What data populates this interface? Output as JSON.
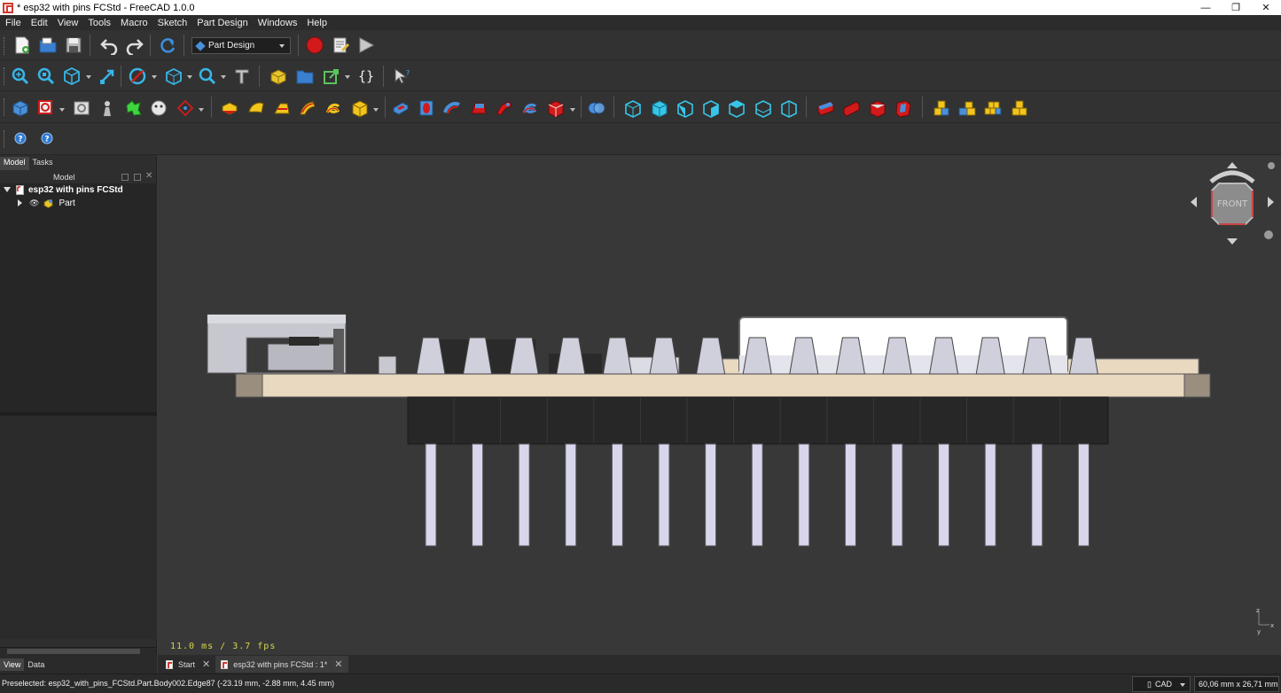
{
  "window": {
    "title": "* esp32 with pins FCStd - FreeCAD 1.0.0",
    "minimize": "—",
    "maximize": "❐",
    "close": "✕"
  },
  "menu": [
    "File",
    "Edit",
    "View",
    "Tools",
    "Macro",
    "Sketch",
    "Part Design",
    "Windows",
    "Help"
  ],
  "workbench": {
    "label": "Part Design"
  },
  "toolbar": {
    "file": [
      "new-document-icon",
      "open-document-icon",
      "save-document-icon",
      "undo-icon",
      "redo-icon",
      "refresh-icon"
    ],
    "macro": [
      "record-macro-icon",
      "macro-editor-icon",
      "execute-macro-icon"
    ],
    "view": [
      "fit-all-icon",
      "fit-selection-icon",
      "isometric-view-icon",
      "bounding-box-icon",
      "draw-style-icon",
      "std-views-icon",
      "measure-icon",
      "part-icon",
      "group-icon",
      "link-icon",
      "expression-icon",
      "whats-this-icon"
    ],
    "partdesign": [
      "body-icon",
      "sketch-icon",
      "attach-icon",
      "datum-point-icon",
      "datum-line-icon",
      "clone-icon",
      "pad-icon",
      "revolution-icon",
      "loft-icon",
      "pipe-icon",
      "helix-icon",
      "additive-box-icon",
      "pocket-icon",
      "hole-icon",
      "groove-icon",
      "subtractive-loft-icon",
      "subtractive-pipe-icon",
      "subtractive-helix-icon",
      "subtractive-box-icon",
      "boolean-icon",
      "mirror-icon",
      "linear-pattern-icon",
      "polar-pattern-icon",
      "scale-icon",
      "multi-transform-icon",
      "fillet-icon",
      "chamfer-icon",
      "draft-icon",
      "thickness-icon"
    ],
    "help": [
      "help-icon",
      "whats-this-help-icon"
    ]
  },
  "left_panel": {
    "tabs": [
      "Model",
      "Tasks"
    ],
    "active_tab": "Model",
    "header": "Model",
    "tree": [
      {
        "label": "esp32 with pins FCStd",
        "expanded": true,
        "level": 0
      },
      {
        "label": "Part",
        "expanded": false,
        "level": 1
      }
    ],
    "bottom_tabs": [
      "View",
      "Data"
    ],
    "active_bottom_tab": "View"
  },
  "viewport": {
    "fps": "11.0 ms / 3.7 fps",
    "navcube_face": "FRONT",
    "axis_labels": [
      "x",
      "y",
      "z"
    ]
  },
  "doc_tabs": [
    {
      "label": "Start",
      "active": false
    },
    {
      "label": "esp32 with pins FCStd : 1*",
      "active": true
    }
  ],
  "status": {
    "text": "Preselected: esp32_with_pins_FCStd.Part.Body002.Edge87 (-23.19 mm, -2.88 mm, 4.45 mm)",
    "nav_style": "CAD",
    "dimension": "60,06 mm x 26,71 mm"
  },
  "colors": {
    "pcb": "#e8d9c0",
    "pcb_edge": "#9a8f7f",
    "header": "#2a2a2a",
    "pins": "#d8d6ec",
    "accent_red": "#d21a1a",
    "workbench_blue": "#4a8fd9"
  }
}
